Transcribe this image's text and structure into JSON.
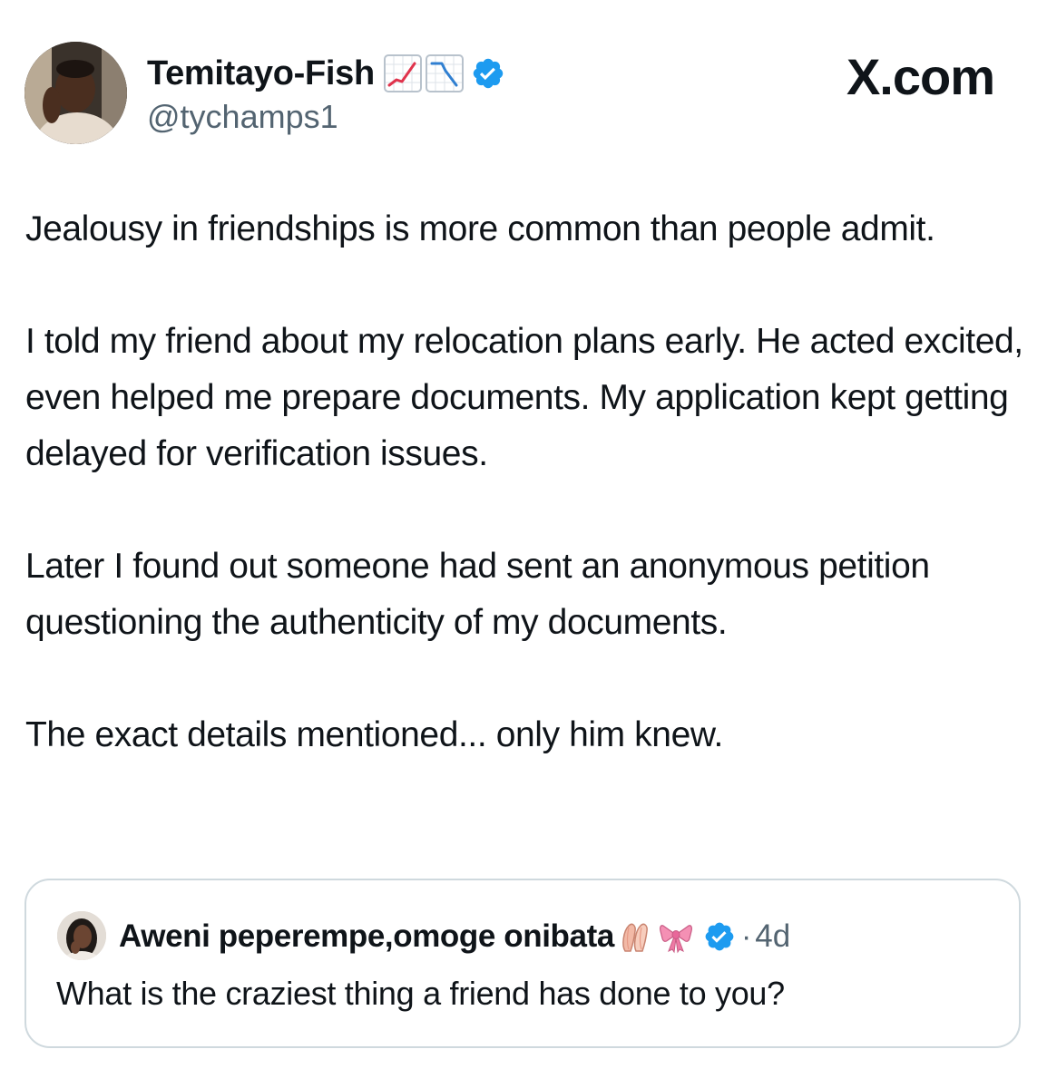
{
  "tweet": {
    "author": {
      "display_name": "Temitayo-Fish",
      "handle": "@tychamps1",
      "name_emojis": [
        "chart-increasing-emoji",
        "chart-decreasing-emoji"
      ],
      "verified": true
    },
    "paragraphs": [
      "Jealousy in friendships is more common than people admit.",
      "I told my friend about my relocation plans early. He acted excited, even helped me prepare documents. My application kept getting delayed for verification issues.",
      "Later I found out someone had sent an anonymous petition questioning the authenticity of my documents.",
      "The exact details mentioned... only him knew."
    ]
  },
  "site_label": "X.com",
  "quoted_tweet": {
    "author": {
      "display_name": "Aweni peperempe,omoge onibata",
      "name_emojis": [
        "ballet-shoes-emoji",
        "ribbon-emoji"
      ],
      "verified": true
    },
    "separator": "·",
    "timestamp": "4d",
    "text": "What is the craziest thing a friend has done to you?"
  },
  "colors": {
    "text_primary": "#0f1419",
    "text_secondary": "#536471",
    "verified_blue": "#1d9bf0",
    "card_border": "#cfd9de"
  }
}
